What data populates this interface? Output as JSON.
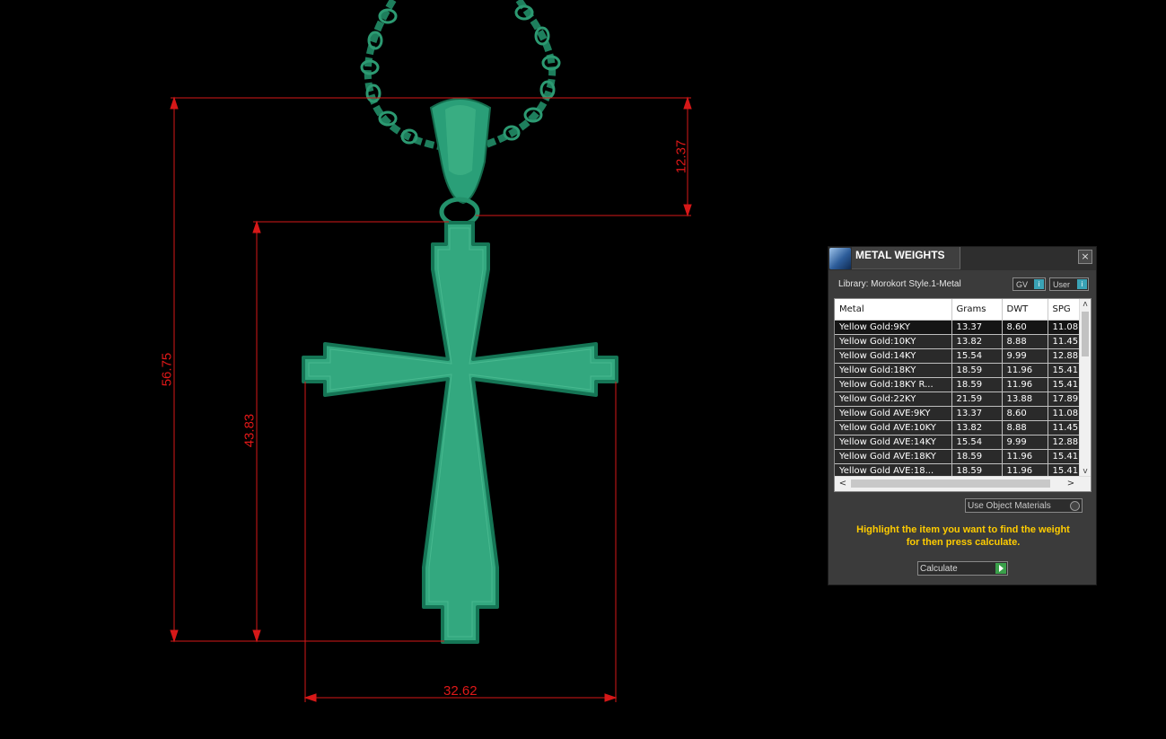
{
  "dimensions": {
    "bail_height": "12.37",
    "cross_height": "43.83",
    "total_height": "56.75",
    "width": "32.62"
  },
  "colors": {
    "model": "#32a27c",
    "model_edge": "#167553",
    "chain": "#1e7f5d",
    "dimension": "#e01818",
    "highlight_text": "#ffcc00"
  },
  "panel": {
    "title": "METAL WEIGHTS",
    "close_icon": "×",
    "library_label": "Library: Morokort Style.1-Metal",
    "gv_label": "GV",
    "gv_value": "i",
    "user_label": "User",
    "user_value": "i",
    "columns": [
      "Metal",
      "Grams",
      "DWT",
      "SPG"
    ],
    "rows": [
      [
        "Yellow Gold:9KY",
        "13.37",
        "8.60",
        "11.08"
      ],
      [
        "Yellow Gold:10KY",
        "13.82",
        "8.88",
        "11.45"
      ],
      [
        "Yellow Gold:14KY",
        "15.54",
        "9.99",
        "12.88"
      ],
      [
        "Yellow Gold:18KY",
        "18.59",
        "11.96",
        "15.41"
      ],
      [
        "Yellow Gold:18KY R...",
        "18.59",
        "11.96",
        "15.41"
      ],
      [
        "Yellow Gold:22KY",
        "21.59",
        "13.88",
        "17.89"
      ],
      [
        "Yellow Gold AVE:9KY",
        "13.37",
        "8.60",
        "11.08"
      ],
      [
        "Yellow Gold AVE:10KY",
        "13.82",
        "8.88",
        "11.45"
      ],
      [
        "Yellow Gold AVE:14KY",
        "15.54",
        "9.99",
        "12.88"
      ],
      [
        "Yellow Gold AVE:18KY",
        "18.59",
        "11.96",
        "15.41"
      ],
      [
        "Yellow Gold AVE:18...",
        "18.59",
        "11.96",
        "15.41"
      ]
    ],
    "scroll_up_icon": "ʌ",
    "scroll_down_icon": "v",
    "scroll_left_icon": "<",
    "scroll_right_icon": ">",
    "use_object_materials_label": "Use Object Materials",
    "instructions_line1": "Highlight the item you want to find the weight",
    "instructions_line2": "for then press calculate.",
    "calculate_label": "Calculate"
  }
}
